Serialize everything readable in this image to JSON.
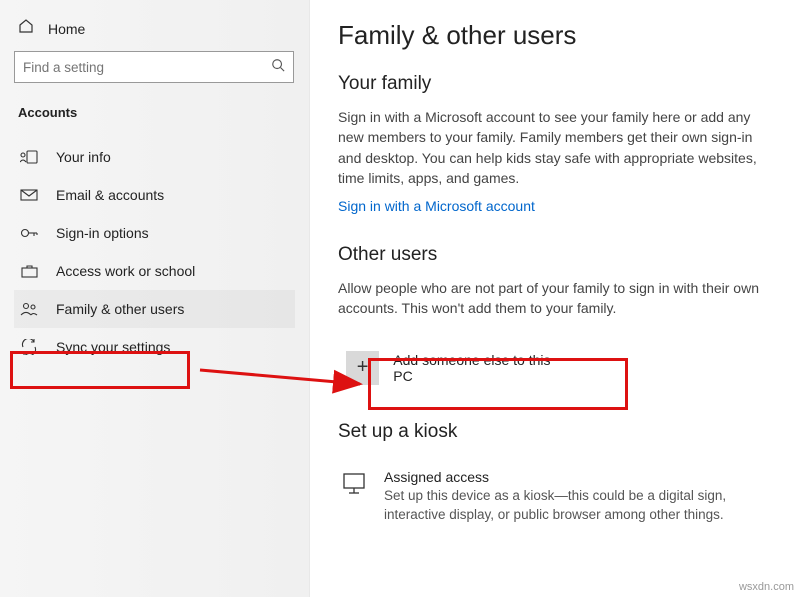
{
  "sidebar": {
    "home": "Home",
    "search_placeholder": "Find a setting",
    "section": "Accounts",
    "items": [
      {
        "label": "Your info"
      },
      {
        "label": "Email & accounts"
      },
      {
        "label": "Sign-in options"
      },
      {
        "label": "Access work or school"
      },
      {
        "label": "Family & other users"
      },
      {
        "label": "Sync your settings"
      }
    ]
  },
  "main": {
    "title": "Family & other users",
    "family_heading": "Your family",
    "family_text": "Sign in with a Microsoft account to see your family here or add any new members to your family. Family members get their own sign-in and desktop. You can help kids stay safe with appropriate websites, time limits, apps, and games.",
    "family_link": "Sign in with a Microsoft account",
    "other_heading": "Other users",
    "other_text": "Allow people who are not part of your family to sign in with their own accounts. This won't add them to your family.",
    "add_label": "Add someone else to this PC",
    "kiosk_heading": "Set up a kiosk",
    "kiosk_title": "Assigned access",
    "kiosk_desc": "Set up this device as a kiosk—this could be a digital sign, interactive display, or public browser among other things."
  },
  "watermark": "wsxdn.com"
}
